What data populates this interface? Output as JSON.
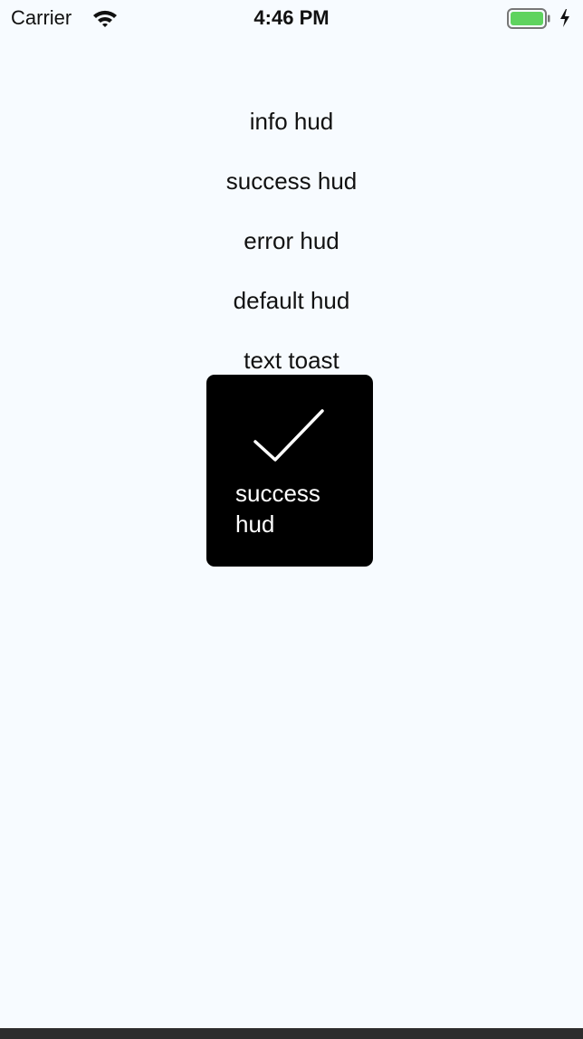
{
  "status_bar": {
    "carrier": "Carrier",
    "time": "4:46 PM",
    "wifi_icon": "wifi-icon",
    "battery_icon": "battery-icon",
    "charging_icon": "charging-bolt-icon",
    "battery_color": "#5fd35f"
  },
  "menu": {
    "items": [
      {
        "label": "info hud"
      },
      {
        "label": "success hud"
      },
      {
        "label": "error hud"
      },
      {
        "label": "default hud"
      },
      {
        "label": "text toast"
      }
    ]
  },
  "hud": {
    "icon": "checkmark-icon",
    "message": "success\nhud",
    "background": "#000000",
    "text_color": "#ffffff"
  },
  "colors": {
    "background": "#f7fbff",
    "bottom_bar": "#2d2d2d"
  }
}
